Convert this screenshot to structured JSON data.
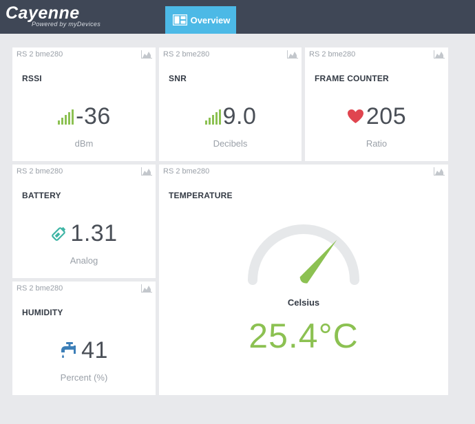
{
  "app": {
    "name": "Cayenne",
    "tagline": "Powered by myDevices",
    "tab_label": "Overview"
  },
  "colors": {
    "topbar": "#3f4756",
    "tab_active": "#4cb9e6",
    "signal_green": "#8cc152",
    "heart_red": "#e0454f",
    "battery_teal": "#3fb5a5",
    "faucet_blue": "#3d7fb8",
    "gauge_track": "#e6e8ea"
  },
  "widgets": {
    "rssi": {
      "device": "RS 2 bme280",
      "title": "RSSI",
      "value": "-36",
      "unit": "dBm",
      "icon": "signal-bars-icon"
    },
    "snr": {
      "device": "RS 2 bme280",
      "title": "SNR",
      "value": "9.0",
      "unit": "Decibels",
      "icon": "signal-bars-icon"
    },
    "frame_counter": {
      "device": "RS 2 bme280",
      "title": "FRAME COUNTER",
      "value": "205",
      "unit": "Ratio",
      "icon": "heart-icon"
    },
    "battery": {
      "device": "RS 2 bme280",
      "title": "BATTERY",
      "value": "1.31",
      "unit": "Analog",
      "icon": "battery-icon"
    },
    "humidity": {
      "device": "RS 2 bme280",
      "title": "HUMIDITY",
      "value": "41",
      "unit": "Percent (%)",
      "icon": "faucet-icon"
    },
    "temperature": {
      "device": "RS 2 bme280",
      "title": "TEMPERATURE",
      "unit": "Celsius",
      "value": "25.4°C",
      "gauge_level": 0.72,
      "icon": "gauge-icon"
    }
  }
}
